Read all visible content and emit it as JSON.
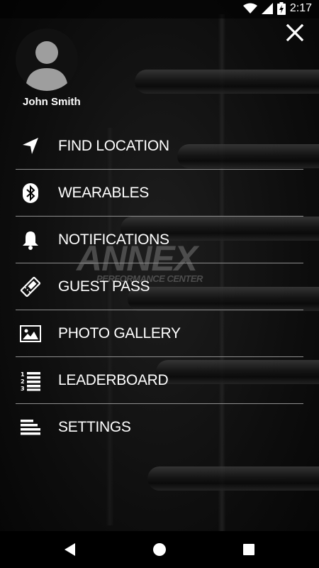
{
  "status": {
    "time": "2:17",
    "battery_glyph": "battery-charging-icon"
  },
  "profile": {
    "name": "John Smith"
  },
  "background": {
    "brand": "ANNEX",
    "tagline": "PERFORMANCE CENTER"
  },
  "menu": {
    "items": [
      {
        "label": "FIND LOCATION",
        "icon": "navigation-arrow-icon"
      },
      {
        "label": "WEARABLES",
        "icon": "bluetooth-icon"
      },
      {
        "label": "NOTIFICATIONS",
        "icon": "bell-icon"
      },
      {
        "label": "GUEST PASS",
        "icon": "ticket-icon"
      },
      {
        "label": "PHOTO GALLERY",
        "icon": "image-icon"
      },
      {
        "label": "LEADERBOARD",
        "icon": "numbered-list-icon"
      },
      {
        "label": "SETTINGS",
        "icon": "settings-lines-icon"
      }
    ]
  },
  "colors": {
    "background": "#0b0b0b",
    "text": "#ffffff",
    "divider": "#8e8e8e"
  }
}
